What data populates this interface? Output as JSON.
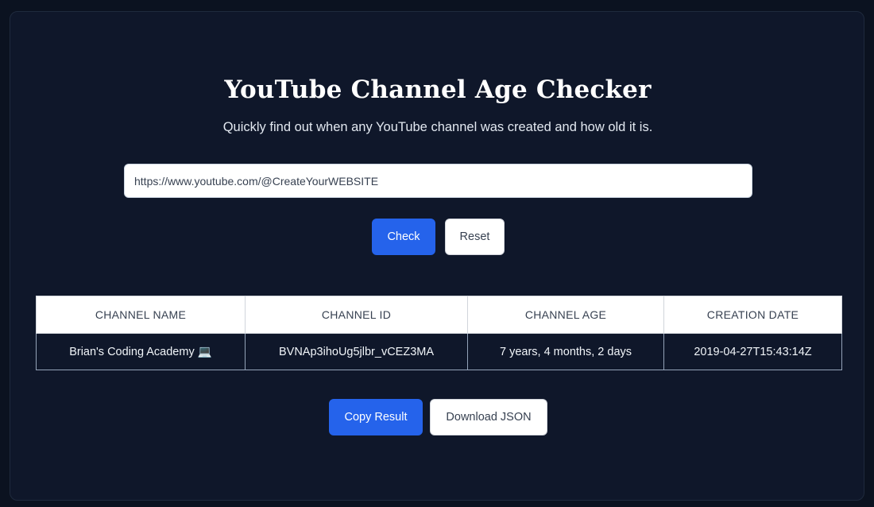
{
  "header": {
    "title": "YouTube Channel Age Checker",
    "subtitle": "Quickly find out when any YouTube channel was created and how old it is."
  },
  "search": {
    "value": "https://www.youtube.com/@CreateYourWEBSITE",
    "placeholder": ""
  },
  "actions": {
    "check_label": "Check",
    "reset_label": "Reset"
  },
  "results": {
    "columns": [
      "CHANNEL NAME",
      "CHANNEL ID",
      "CHANNEL AGE",
      "CREATION DATE"
    ],
    "rows": [
      {
        "channel_name": "Brian's Coding Academy 💻",
        "channel_id": "BVNAp3ihoUg5jlbr_vCEZ3MA",
        "channel_age": "7 years, 4 months, 2 days",
        "creation_date": "2019-04-27T15:43:14Z"
      }
    ]
  },
  "export": {
    "copy_label": "Copy Result",
    "download_label": "Download JSON"
  },
  "colors": {
    "page_background": "#0b1220",
    "card_background": "#0f172a",
    "accent": "#2563eb"
  }
}
